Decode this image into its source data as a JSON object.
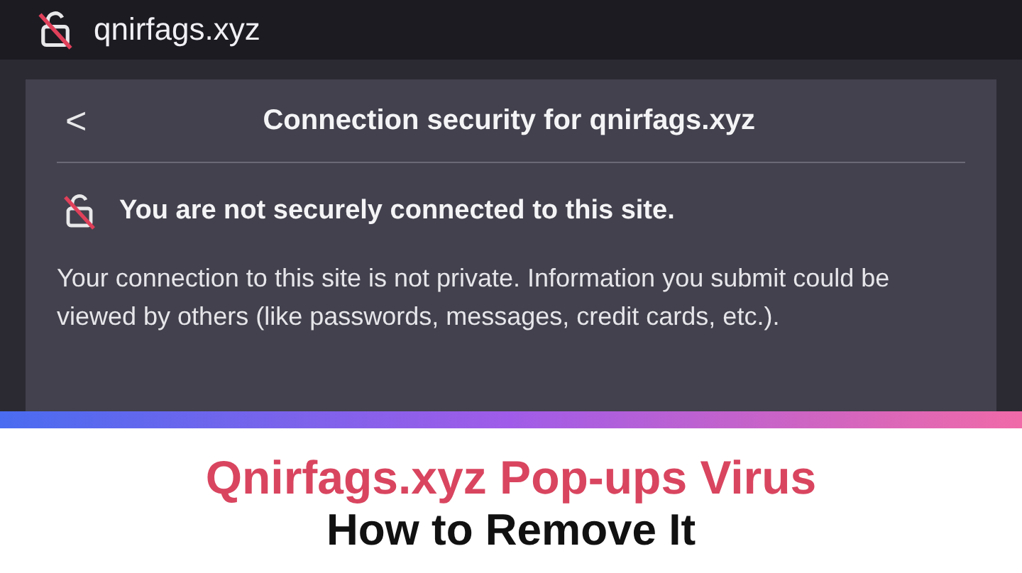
{
  "address_bar": {
    "url": "qnirfags.xyz"
  },
  "panel": {
    "back": "<",
    "title": "Connection security for qnirfags.xyz",
    "warning": "You are not securely connected to this site.",
    "description": "Your connection to this site is not private. Information you submit could be viewed by others (like passwords, messages, credit cards, etc.)."
  },
  "banner": {
    "headline": "Qnirfags.xyz Pop-ups Virus",
    "subheadline": "How to Remove It"
  }
}
